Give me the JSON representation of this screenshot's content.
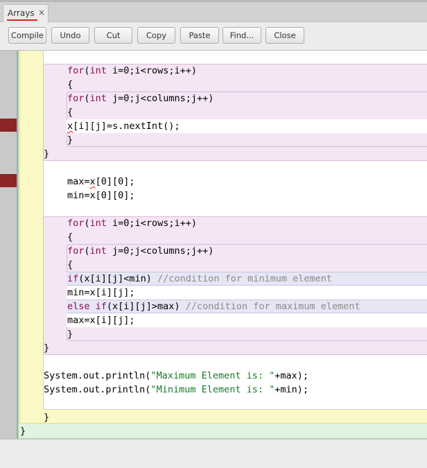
{
  "tab": {
    "title": "Arrays",
    "close_icon": "×"
  },
  "toolbar": {
    "compile": "Compile",
    "undo": "Undo",
    "cut": "Cut",
    "copy": "Copy",
    "paste": "Paste",
    "find": "Find...",
    "close": "Close"
  },
  "code": {
    "loop1_for": "for",
    "loop1_int": "int",
    "loop1_rest": " i=0;i<rows;i++)",
    "loop1_open": "{",
    "loop1_inner_for": "for",
    "loop1_inner_int": "int",
    "loop1_inner_rest": " j=0;j<columns;j++)",
    "loop1_inner_open": "{",
    "read_x": "x",
    "read_rest": "[i][j]=s.nextInt();",
    "loop1_inner_close": "}",
    "loop1_close": "}",
    "max_init_a": "max=",
    "max_init_x": "x",
    "max_init_b": "[0][0];",
    "min_init": "min=x[0][0];",
    "loop2_for": "for",
    "loop2_int": "int",
    "loop2_rest": " i=0;i<rows;i++)",
    "loop2_open": "{",
    "loop2_inner_for": "for",
    "loop2_inner_int": "int",
    "loop2_inner_rest": " j=0;j<columns;j++)",
    "loop2_inner_open": "{",
    "if_kw": "if",
    "if_cond": "(x[i][j]<min) ",
    "if_comment": "//condition for minimum element",
    "min_assign": "min=x[i][j];",
    "else_kw": "else if",
    "else_cond": "(x[i][j]>max) ",
    "else_comment": "//condition for maximum element",
    "max_assign": "max=x[i][j];",
    "loop2_inner_close": "}",
    "loop2_close": "}",
    "print1_a": "System.out.println(",
    "print1_str": "\"Maximum Element is: \"",
    "print1_b": "+max);",
    "print2_a": "System.out.println(",
    "print2_str": "\"Minimum Element is: \"",
    "print2_b": "+min);",
    "method_close": "}",
    "class_close": "}"
  },
  "colors": {
    "keyword": "#8b0d57",
    "string": "#177a24",
    "comment": "#8a8a8a",
    "breakpoint": "#8c2526"
  }
}
